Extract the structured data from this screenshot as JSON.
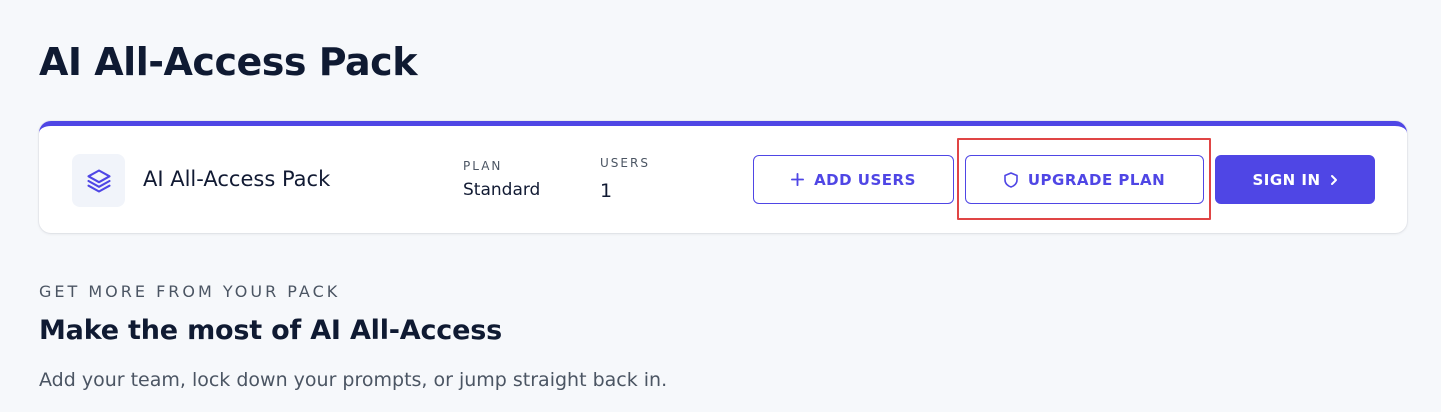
{
  "page": {
    "title": "AI All-Access Pack"
  },
  "pack_card": {
    "name": "AI All-Access Pack",
    "icon": "layers-icon",
    "plan_label": "PLAN",
    "plan_value": "Standard",
    "users_label": "USERS",
    "users_value": "1",
    "accent_color": "#4f46e5",
    "buttons": {
      "add_users": {
        "label": "ADD USERS",
        "icon": "plus-icon"
      },
      "upgrade_plan": {
        "label": "UPGRADE PLAN",
        "icon": "shield-icon"
      },
      "sign_in": {
        "label": "SIGN IN",
        "icon": "chevron-right-icon"
      }
    }
  },
  "highlight": {
    "color": "#e04545"
  },
  "section": {
    "eyebrow": "GET MORE FROM YOUR PACK",
    "title": "Make the most of AI All-Access",
    "description": "Add your team, lock down your prompts, or jump straight back in."
  }
}
